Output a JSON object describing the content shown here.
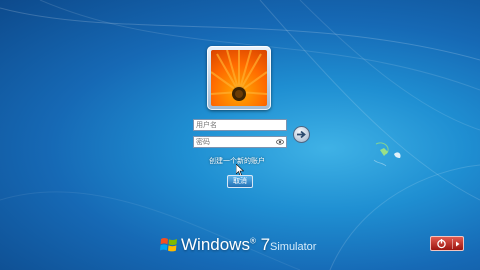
{
  "login": {
    "username_placeholder": "用户名",
    "password_placeholder": "密码",
    "create_account_link": "创建一个新的账户",
    "cancel_button": "取消"
  },
  "branding": {
    "product": "Windows",
    "version": "7",
    "suffix": "Simulator"
  },
  "colors": {
    "background": "#1f8fd2",
    "power_button": "#c0281f"
  },
  "icons": {
    "submit": "arrow-right-icon",
    "power": "power-icon",
    "logo": "windows-logo-icon"
  }
}
